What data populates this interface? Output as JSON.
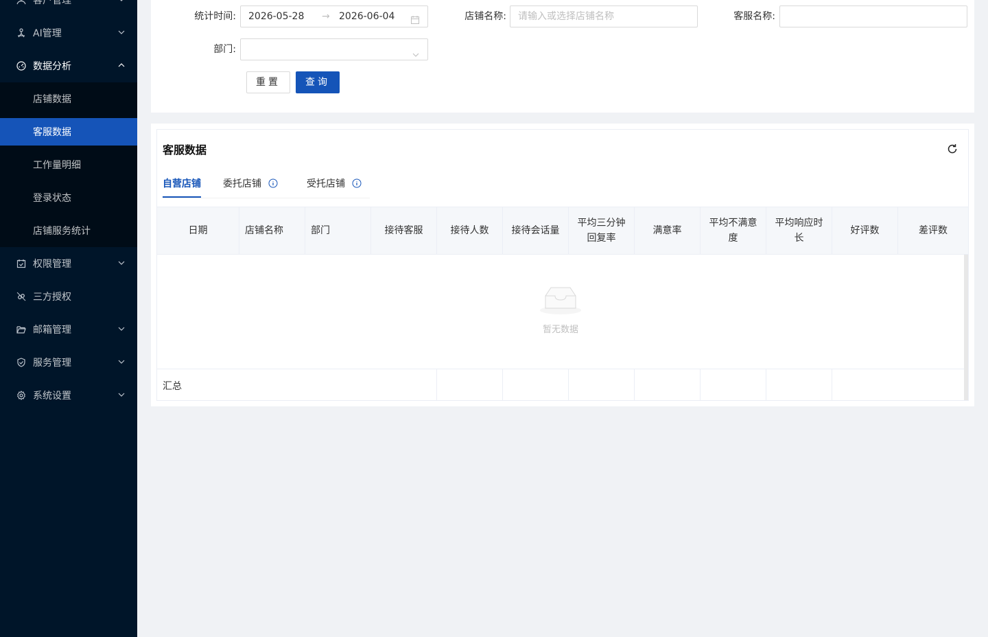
{
  "sidebar": {
    "top_cut_label": "客户管理",
    "items": [
      {
        "label": "AI管理",
        "icon": "robot-icon"
      },
      {
        "label": "数据分析",
        "icon": "dashboard-icon",
        "open": true,
        "children": [
          "店铺数据",
          "客服数据",
          "工作量明细",
          "登录状态",
          "店铺服务统计"
        ],
        "active_child": "客服数据"
      },
      {
        "label": "权限管理",
        "icon": "calendar-check-icon"
      },
      {
        "label": "三方授权",
        "icon": "link-icon"
      },
      {
        "label": "邮箱管理",
        "icon": "folder-open-icon"
      },
      {
        "label": "服务管理",
        "icon": "shield-check-icon"
      },
      {
        "label": "系统设置",
        "icon": "gear-icon"
      }
    ]
  },
  "filters": {
    "time_label": "统计时间:",
    "date_start": "2026-05-28",
    "date_end": "2026-06-04",
    "date_sep": "→",
    "shop_label": "店铺名称:",
    "shop_placeholder": "请输入或选择店铺名称",
    "agent_label": "客服名称:",
    "agent_value": "",
    "dept_label": "部门:",
    "dept_value": "",
    "reset_label": "重置",
    "query_label": "查询"
  },
  "card": {
    "title": "客服数据",
    "tabs": [
      {
        "label": "自营店铺",
        "active": true
      },
      {
        "label": "委托店铺",
        "info": true
      },
      {
        "label": "受托店铺",
        "info": true
      }
    ]
  },
  "table": {
    "columns": [
      "日期",
      "店铺名称",
      "部门",
      "接待客服",
      "接待人数",
      "接待会话量",
      "平均三分钟回复率",
      "满意率",
      "平均不满意度",
      "平均响应时长",
      "好评数",
      "差评数"
    ],
    "empty_text": "暂无数据",
    "summary_label": "汇总",
    "rows": []
  },
  "colors": {
    "sidebar_bg": "#001529",
    "submenu_bg": "#000c17",
    "primary": "#1554b8"
  }
}
